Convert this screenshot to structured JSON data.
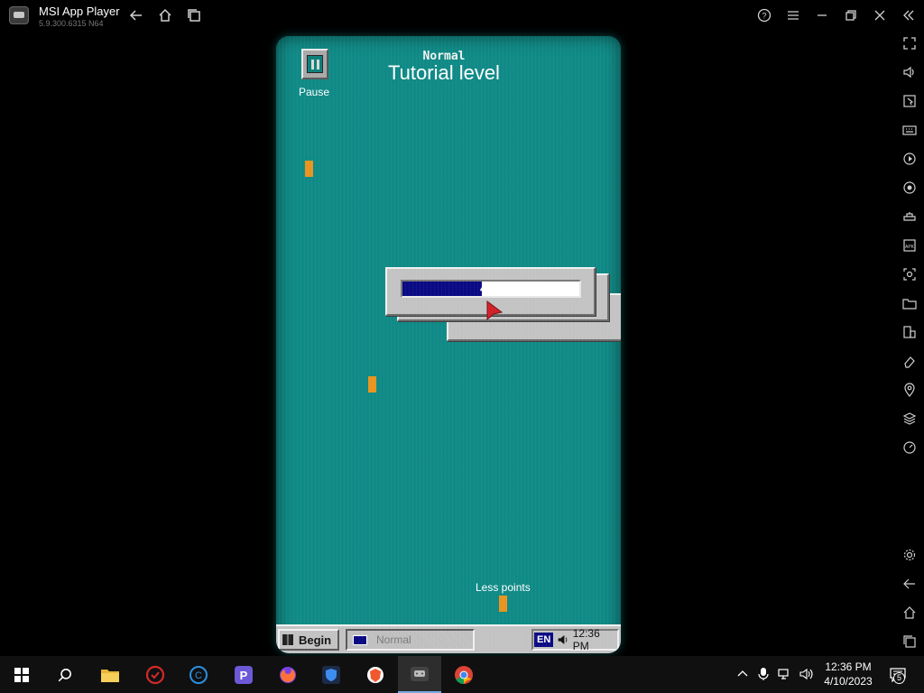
{
  "emulator": {
    "title": "MSI App Player",
    "version": "5.9.300.6315 N64"
  },
  "game": {
    "mode_label": "Normal",
    "level_title": "Tutorial level",
    "pause_label": "Pause",
    "progress_text": "45%",
    "progress_fraction": 0.45,
    "less_points_label": "Less points",
    "taskbar": {
      "begin_label": "Begin",
      "task_label": "Normal",
      "language": "EN",
      "clock": "12:36 PM"
    }
  },
  "system_taskbar": {
    "clock_time": "12:36 PM",
    "clock_date": "4/10/2023",
    "notification_count": "5",
    "apps": [
      "start-icon",
      "search-icon",
      "file-explorer-icon",
      "antivirus-icon",
      "ccleaner-icon",
      "p-app-icon",
      "firefox-icon",
      "vpn-shield-icon",
      "brave-icon",
      "msi-app-player-icon",
      "chrome-icon"
    ]
  },
  "colors": {
    "game_background": "#108a86",
    "progress_fill": "#0a0a84",
    "block": "#e8941f",
    "window_face": "#c3c3c3"
  }
}
